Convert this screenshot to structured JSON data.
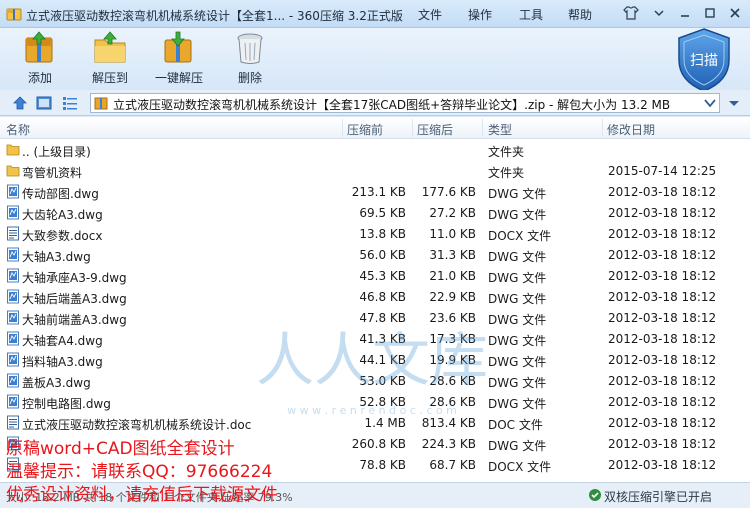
{
  "window": {
    "title": "立式液压驱动数控滚弯机机械系统设计【全套1... - 360压缩 3.2正式版",
    "menus": [
      "文件",
      "操作",
      "工具",
      "帮助"
    ]
  },
  "toolbar": {
    "add_label": "添加",
    "extract_label": "解压到",
    "one_click_label": "一键解压",
    "delete_label": "删除",
    "scan_label": "扫描"
  },
  "address": {
    "path": "立式液压驱动数控滚弯机机械系统设计【全套17张CAD图纸+答辩毕业论文】.zip - 解包大小为 13.2 MB"
  },
  "columns": {
    "name": "名称",
    "size": "压缩前",
    "csize": "压缩后",
    "type": "类型",
    "mtime": "修改日期"
  },
  "files": [
    {
      "name": ".. (上级目录)",
      "size": "",
      "csize": "",
      "type": "文件夹",
      "mtime": "",
      "icon": "folder-icon"
    },
    {
      "name": "弯管机资料",
      "size": "",
      "csize": "",
      "type": "文件夹",
      "mtime": "2015-07-14 12:25",
      "icon": "folder-icon"
    },
    {
      "name": "传动部图.dwg",
      "size": "213.1 KB",
      "csize": "177.6 KB",
      "type": "DWG 文件",
      "mtime": "2012-03-18 18:12",
      "icon": "dwg-icon"
    },
    {
      "name": "大齿轮A3.dwg",
      "size": "69.5 KB",
      "csize": "27.2 KB",
      "type": "DWG 文件",
      "mtime": "2012-03-18 18:12",
      "icon": "dwg-icon"
    },
    {
      "name": "大致参数.docx",
      "size": "13.8 KB",
      "csize": "11.0 KB",
      "type": "DOCX 文件",
      "mtime": "2012-03-18 18:12",
      "icon": "doc-icon"
    },
    {
      "name": "大轴A3.dwg",
      "size": "56.0 KB",
      "csize": "31.3 KB",
      "type": "DWG 文件",
      "mtime": "2012-03-18 18:12",
      "icon": "dwg-icon"
    },
    {
      "name": "大轴承座A3-9.dwg",
      "size": "45.3 KB",
      "csize": "21.0 KB",
      "type": "DWG 文件",
      "mtime": "2012-03-18 18:12",
      "icon": "dwg-icon"
    },
    {
      "name": "大轴后端盖A3.dwg",
      "size": "46.8 KB",
      "csize": "22.9 KB",
      "type": "DWG 文件",
      "mtime": "2012-03-18 18:12",
      "icon": "dwg-icon"
    },
    {
      "name": "大轴前端盖A3.dwg",
      "size": "47.8 KB",
      "csize": "23.6 KB",
      "type": "DWG 文件",
      "mtime": "2012-03-18 18:12",
      "icon": "dwg-icon"
    },
    {
      "name": "大轴套A4.dwg",
      "size": "41.3 KB",
      "csize": "17.3 KB",
      "type": "DWG 文件",
      "mtime": "2012-03-18 18:12",
      "icon": "dwg-icon"
    },
    {
      "name": "挡料轴A3.dwg",
      "size": "44.1 KB",
      "csize": "19.9 KB",
      "type": "DWG 文件",
      "mtime": "2012-03-18 18:12",
      "icon": "dwg-icon"
    },
    {
      "name": "盖板A3.dwg",
      "size": "53.0 KB",
      "csize": "28.6 KB",
      "type": "DWG 文件",
      "mtime": "2012-03-18 18:12",
      "icon": "dwg-icon"
    },
    {
      "name": "控制电路图.dwg",
      "size": "52.8 KB",
      "csize": "28.6 KB",
      "type": "DWG 文件",
      "mtime": "2012-03-18 18:12",
      "icon": "dwg-icon"
    },
    {
      "name": "立式液压驱动数控滚弯机机械系统设计.doc",
      "size": "1.4 MB",
      "csize": "813.4 KB",
      "type": "DOC 文件",
      "mtime": "2012-03-18 18:12",
      "icon": "doc-icon"
    },
    {
      "name": "",
      "size": "260.8 KB",
      "csize": "224.3 KB",
      "type": "DWG 文件",
      "mtime": "2012-03-18 18:12",
      "icon": "dwg-icon"
    },
    {
      "name": "",
      "size": "78.8 KB",
      "csize": "68.7 KB",
      "type": "DOCX 文件",
      "mtime": "2012-03-18 18:12",
      "icon": "doc-icon"
    }
  ],
  "overlay": {
    "line1": "原稿word+CAD图纸全套设计",
    "line2": "温馨提示：请联系QQ：97666224",
    "line3": "优秀设计资料，请充值后下载源文件"
  },
  "watermark": {
    "text": "人人文库",
    "url": "w w w . r e n r e n d o c . c o m"
  },
  "status": {
    "left": "大小: 13.2 MB 共 18 个文件和 1 个文件夹 压缩率 79.3%",
    "right": "双核压缩引擎已开启"
  }
}
